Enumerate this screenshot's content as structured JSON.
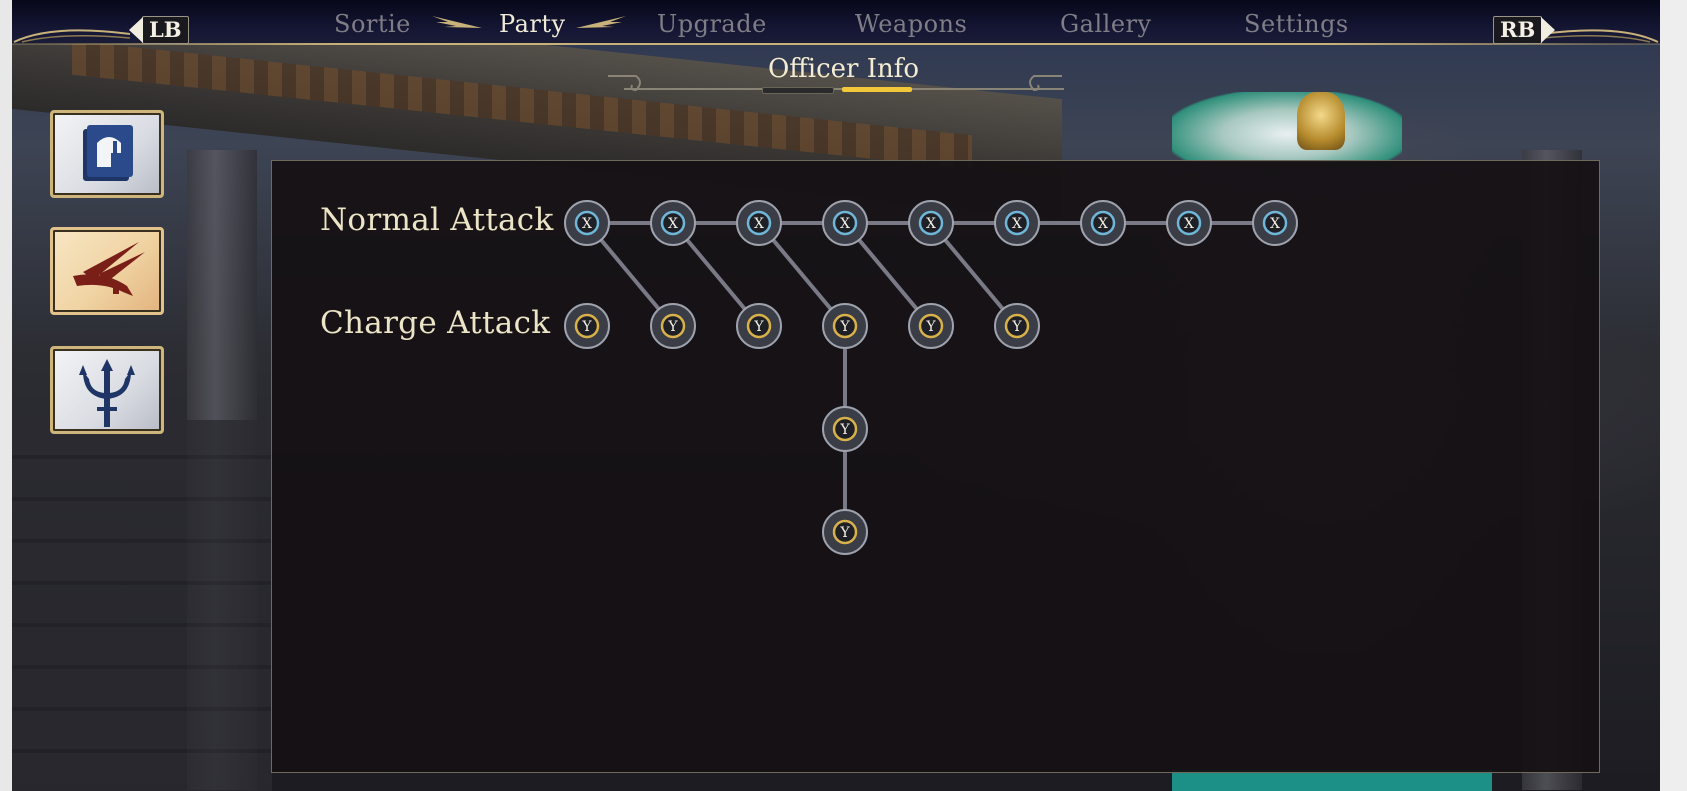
{
  "nav": {
    "left_bumper": "LB",
    "right_bumper": "RB",
    "tabs": [
      {
        "label": "Sortie",
        "active": false
      },
      {
        "label": "Party",
        "active": true
      },
      {
        "label": "Upgrade",
        "active": false
      },
      {
        "label": "Weapons",
        "active": false
      },
      {
        "label": "Gallery",
        "active": false
      },
      {
        "label": "Settings",
        "active": false
      }
    ]
  },
  "section": {
    "title": "Officer Info"
  },
  "side_icons": [
    {
      "icon": "officer-profile-icon",
      "active": false
    },
    {
      "icon": "attack-combo-icon",
      "active": true
    },
    {
      "icon": "trident-weapon-icon",
      "active": false
    }
  ],
  "moveset": {
    "normal_label": "Normal Attack",
    "charge_label": "Charge Attack",
    "normal_button": "X",
    "charge_button": "Y",
    "normal_count": 9,
    "charge_count": 6,
    "charge_branches_from_normal": [
      1,
      2,
      3,
      4,
      5
    ],
    "extended_chain": {
      "charge_index": 3,
      "extra_nodes": 2
    }
  },
  "colors": {
    "gold": "#c8b27a",
    "normal_ring": "#6fb6d8",
    "charge_ring": "#d8b14a",
    "active_underline": "#f2c83a"
  }
}
